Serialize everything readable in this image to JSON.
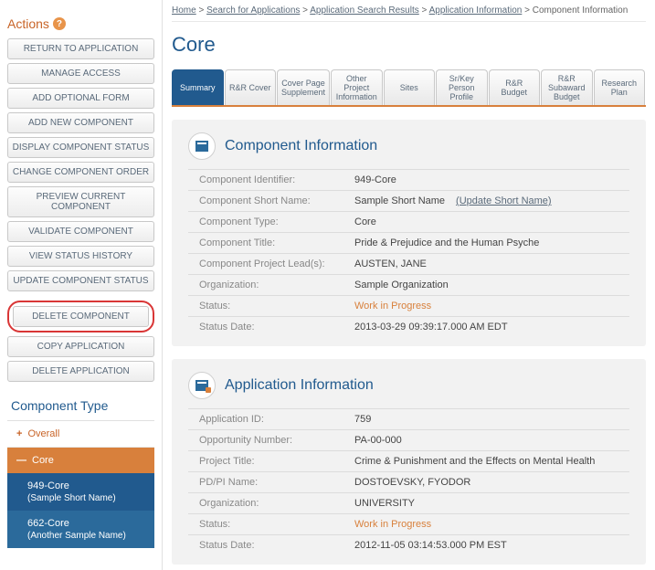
{
  "breadcrumb": [
    {
      "label": "Home"
    },
    {
      "label": "Search for Applications"
    },
    {
      "label": "Application Search Results"
    },
    {
      "label": "Application Information"
    },
    {
      "label": "Component Information"
    }
  ],
  "page_title": "Core",
  "sidebar": {
    "actions_title": "Actions",
    "buttons": {
      "return": "RETURN TO APPLICATION",
      "manage_access": "MANAGE ACCESS",
      "add_optional": "ADD OPTIONAL FORM",
      "add_component": "ADD NEW COMPONENT",
      "display_status": "DISPLAY COMPONENT STATUS",
      "change_order": "CHANGE COMPONENT ORDER",
      "preview": "PREVIEW CURRENT COMPONENT",
      "validate": "VALIDATE COMPONENT",
      "view_history": "VIEW STATUS HISTORY",
      "update_status": "UPDATE COMPONENT STATUS",
      "delete": "DELETE COMPONENT",
      "copy_app": "COPY APPLICATION",
      "delete_app": "DELETE APPLICATION"
    },
    "component_type_title": "Component Type",
    "tree": {
      "overall": "Overall",
      "core": "Core",
      "subs": [
        {
          "id": "949-Core",
          "name": "(Sample Short Name)"
        },
        {
          "id": "662-Core",
          "name": "(Another Sample Name)"
        }
      ]
    }
  },
  "tabs": [
    "Summary",
    "R&R Cover",
    "Cover Page Supplement",
    "Other Project Information",
    "Sites",
    "Sr/Key Person Profile",
    "R&R Budget",
    "R&R Subaward Budget",
    "Research Plan"
  ],
  "component_info": {
    "title": "Component Information",
    "rows": {
      "identifier_label": "Component Identifier:",
      "identifier_value": "949-Core",
      "shortname_label": "Component Short Name:",
      "shortname_value": "Sample Short Name",
      "shortname_link": "(Update Short Name)",
      "type_label": "Component Type:",
      "type_value": "Core",
      "ctitle_label": "Component Title:",
      "ctitle_value": "Pride & Prejudice and the Human Psyche",
      "lead_label": "Component Project Lead(s):",
      "lead_value": "AUSTEN, JANE",
      "org_label": "Organization:",
      "org_value": "Sample Organization",
      "status_label": "Status:",
      "status_value": "Work in Progress",
      "date_label": "Status Date:",
      "date_value": "2013-03-29 09:39:17.000 AM EDT"
    }
  },
  "app_info": {
    "title": "Application Information",
    "rows": {
      "appid_label": "Application ID:",
      "appid_value": "759",
      "opp_label": "Opportunity Number:",
      "opp_value": "PA-00-000",
      "ptitle_label": "Project Title:",
      "ptitle_value": "Crime & Punishment and the Effects on Mental Health",
      "pdpi_label": "PD/PI Name:",
      "pdpi_value": "DOSTOEVSKY, FYODOR",
      "org_label": "Organization:",
      "org_value": "UNIVERSITY",
      "status_label": "Status:",
      "status_value": "Work in Progress",
      "date_label": "Status Date:",
      "date_value": "2012-11-05 03:14:53.000 PM EST"
    }
  }
}
